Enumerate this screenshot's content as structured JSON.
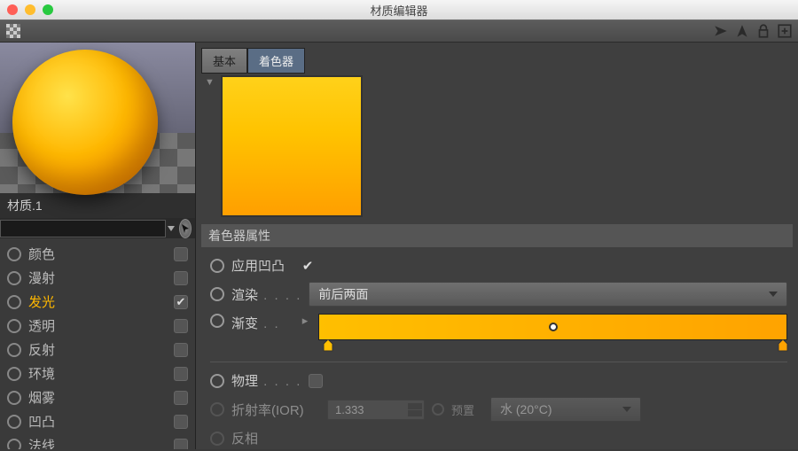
{
  "window": {
    "title": "材质编辑器"
  },
  "material": {
    "name": "材质.1"
  },
  "left": {
    "search_placeholder": "",
    "channels": [
      {
        "label": "颜色",
        "checked": false,
        "active": false
      },
      {
        "label": "漫射",
        "checked": false,
        "active": false
      },
      {
        "label": "发光",
        "checked": true,
        "active": true
      },
      {
        "label": "透明",
        "checked": false,
        "active": false
      },
      {
        "label": "反射",
        "checked": false,
        "active": false
      },
      {
        "label": "环境",
        "checked": false,
        "active": false
      },
      {
        "label": "烟雾",
        "checked": false,
        "active": false
      },
      {
        "label": "凹凸",
        "checked": false,
        "active": false
      },
      {
        "label": "法线",
        "checked": false,
        "active": false
      }
    ]
  },
  "tabs": [
    {
      "label": "基本",
      "active": false
    },
    {
      "label": "着色器",
      "active": true
    }
  ],
  "shader": {
    "section_title": "着色器属性",
    "apply_bump_label": "应用凹凸",
    "apply_bump_checked": true,
    "render_label": "渲染",
    "render_value": "前后两面",
    "gradient_label": "渐变",
    "gradient": {
      "start_color": "#ffbf00",
      "end_color": "#ffa300",
      "knot_position_pct": 50,
      "handles_pct": [
        2,
        99
      ]
    },
    "physical_label": "物理",
    "physical_checked": false,
    "ior_label": "折射率(IOR)",
    "ior_value": "1.333",
    "preset_label": "预置",
    "preset_value": "水 (20°C)",
    "invert_label": "反相"
  }
}
